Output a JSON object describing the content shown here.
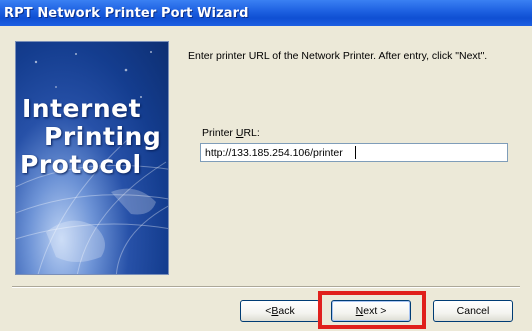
{
  "window": {
    "title": "RPT Network Printer Port Wizard"
  },
  "side_image": {
    "logo_lines": [
      "Internet",
      "Printing",
      "Protocol"
    ]
  },
  "content": {
    "instruction": "Enter printer URL of the Network Printer. After entry, click \"Next\".",
    "url_label_prefix": "Printer ",
    "url_label_accel": "U",
    "url_label_suffix": "RL:",
    "url_value": "http://133.185.254.106/printer"
  },
  "buttons": {
    "back_prefix": "< ",
    "back_accel": "B",
    "back_suffix": "ack",
    "next_accel": "N",
    "next_suffix": "ext >",
    "cancel": "Cancel"
  },
  "colors": {
    "title_bar": "#0f4fd3",
    "highlight": "#e0201c",
    "dialog_background": "#ece9d8"
  }
}
